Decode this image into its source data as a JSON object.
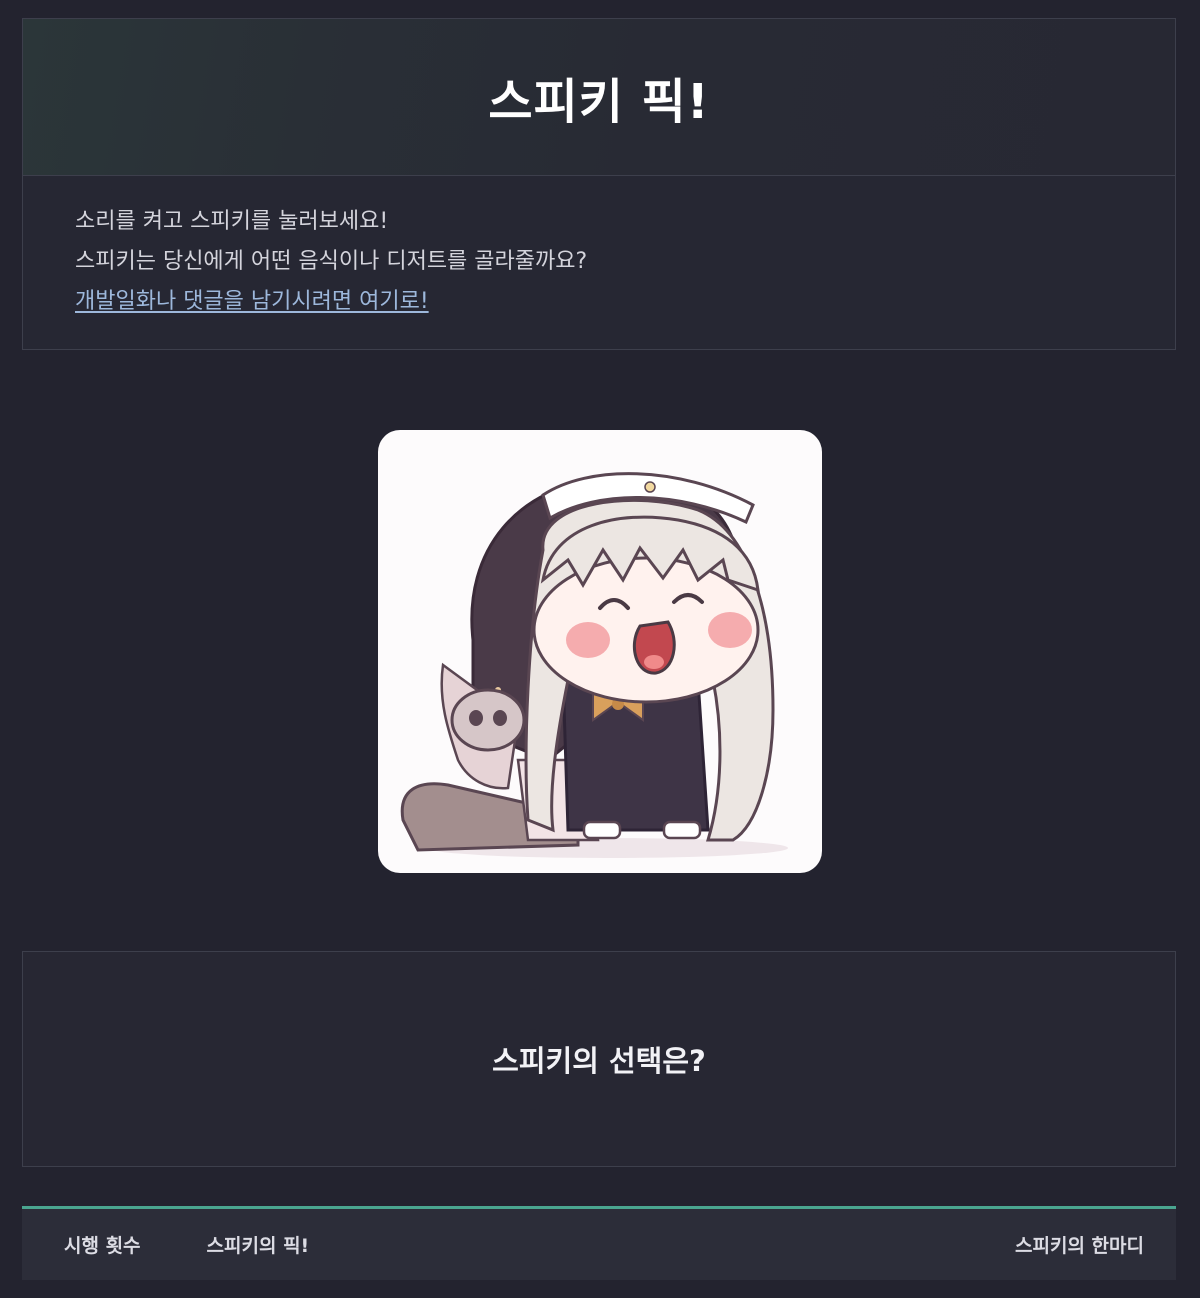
{
  "header": {
    "title": "스피키 픽!",
    "lines": [
      "소리를 켜고 스피키를 눌러보세요!",
      "스피키는 당신에게 어떤 음식이나 디저트를 골라줄까요?"
    ],
    "link_text": "개발일화나 댓글을 남기시려면 여기로!"
  },
  "sticker": {
    "icon": "speaky-character-sticker"
  },
  "result": {
    "title": "스피키의 선택은?"
  },
  "tabs": [
    {
      "label": "시행 횟수"
    },
    {
      "label": "스피키의 픽!"
    },
    {
      "label": "스피키의 한마디"
    }
  ],
  "colors": {
    "background": "#23232f",
    "accent": "#4aa590",
    "link": "#9db8dc"
  }
}
